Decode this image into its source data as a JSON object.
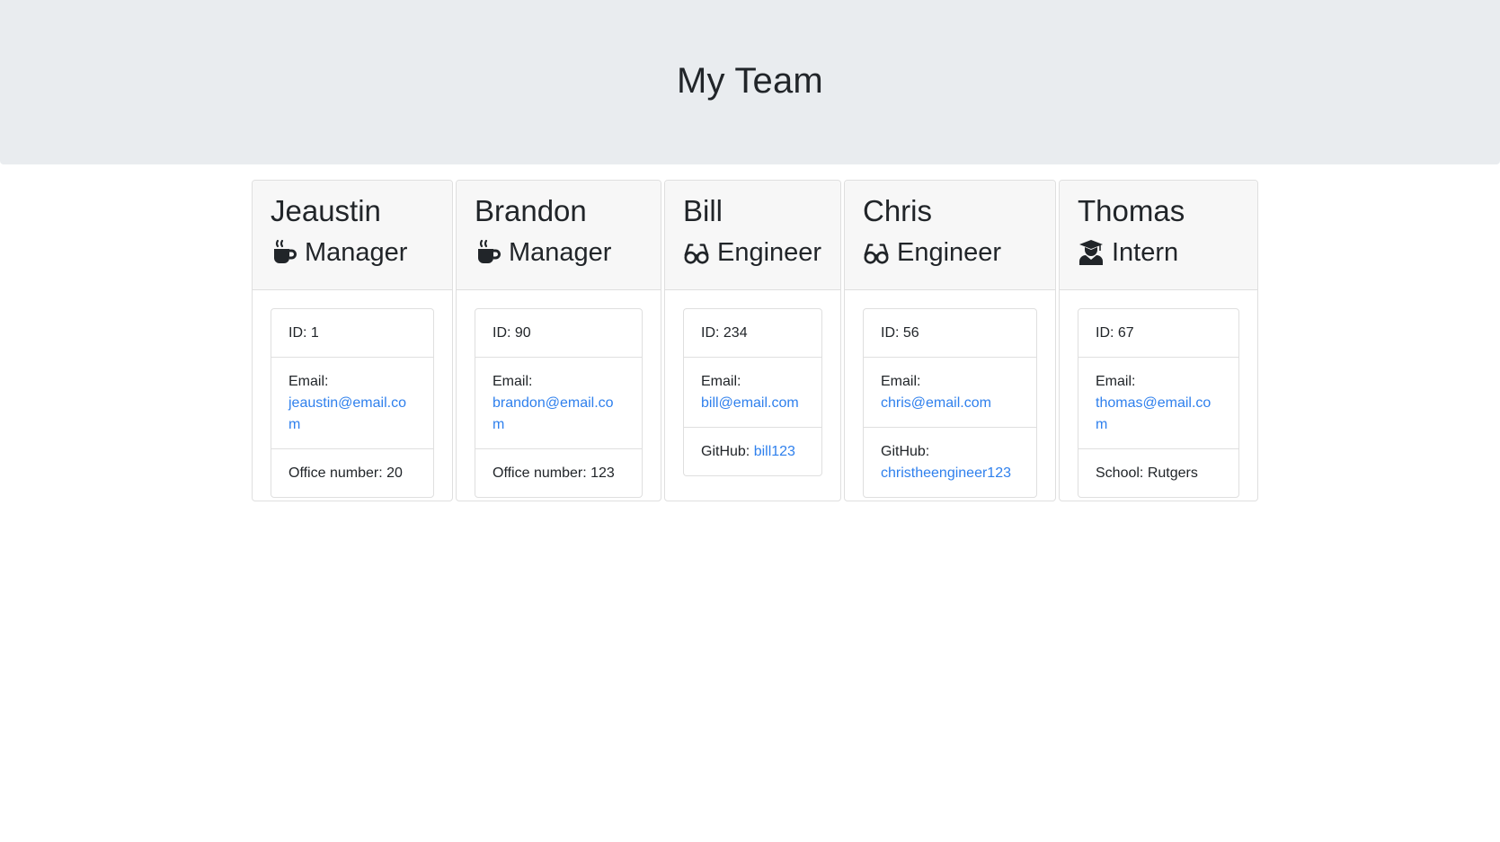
{
  "header": {
    "title": "My Team"
  },
  "cards": [
    {
      "name": "Jeaustin",
      "role": "Manager",
      "icon": "coffee-mug-icon",
      "id_text": "ID: 1",
      "email_label": "Email:",
      "email": "jeaustin@email.com",
      "extra_label": "Office number: 20",
      "extra_link": ""
    },
    {
      "name": "Brandon",
      "role": "Manager",
      "icon": "coffee-mug-icon",
      "id_text": "ID: 90",
      "email_label": "Email:",
      "email": "brandon@email.com",
      "extra_label": "Office number: 123",
      "extra_link": ""
    },
    {
      "name": "Bill",
      "role": "Engineer",
      "icon": "glasses-icon",
      "id_text": "ID: 234",
      "email_label": "Email:",
      "email": "bill@email.com",
      "extra_label": "GitHub: ",
      "extra_link": "bill123"
    },
    {
      "name": "Chris",
      "role": "Engineer",
      "icon": "glasses-icon",
      "id_text": "ID: 56",
      "email_label": "Email:",
      "email": "chris@email.com",
      "extra_label": "GitHub: ",
      "extra_link": "christheengineer123"
    },
    {
      "name": "Thomas",
      "role": "Intern",
      "icon": "graduate-icon",
      "id_text": "ID: 67",
      "email_label": "Email:",
      "email": "thomas@email.com",
      "extra_label": "School: Rutgers",
      "extra_link": ""
    }
  ],
  "colors": {
    "header_bg": "#e9ecef",
    "card_header_bg": "#f7f7f7",
    "link": "#2f80ed",
    "text": "#212529"
  }
}
